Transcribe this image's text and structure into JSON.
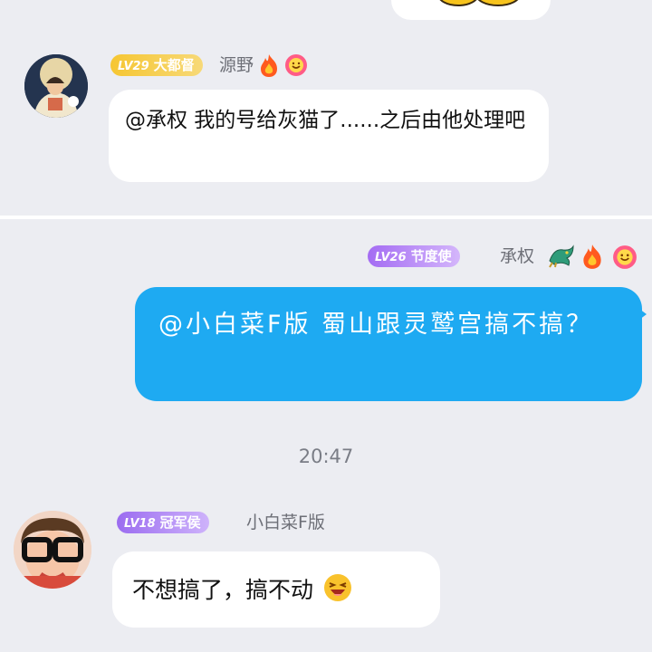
{
  "messages": [
    {
      "level": "LV29",
      "title": "大都督",
      "sender": "源野",
      "text": "@承权 我的号给灰猫了......之后由他处理吧",
      "badge_colors": [
        "#f6c632",
        "#f6d773"
      ]
    },
    {
      "level": "LV26",
      "title": "节度使",
      "sender": "承权",
      "text": "@小白菜F版 蜀山跟灵鹫宫搞不搞？",
      "badge_colors": [
        "#a46cf3",
        "#d3b2fb"
      ]
    },
    {
      "level": "LV18",
      "title": "冠军侯",
      "sender": "小白菜F版",
      "text": "不想搞了，搞不动",
      "badge_colors": [
        "#9b6cf0",
        "#cdb1fa"
      ]
    }
  ],
  "timestamp": "20:47",
  "colors": {
    "background": "#ecedf2",
    "own_bubble": "#1eaaf2",
    "other_bubble": "#ffffff"
  },
  "icons": [
    "fire-icon",
    "smile-flower-icon",
    "dragon-icon",
    "laughing-emoji-icon",
    "duck-sticker"
  ]
}
